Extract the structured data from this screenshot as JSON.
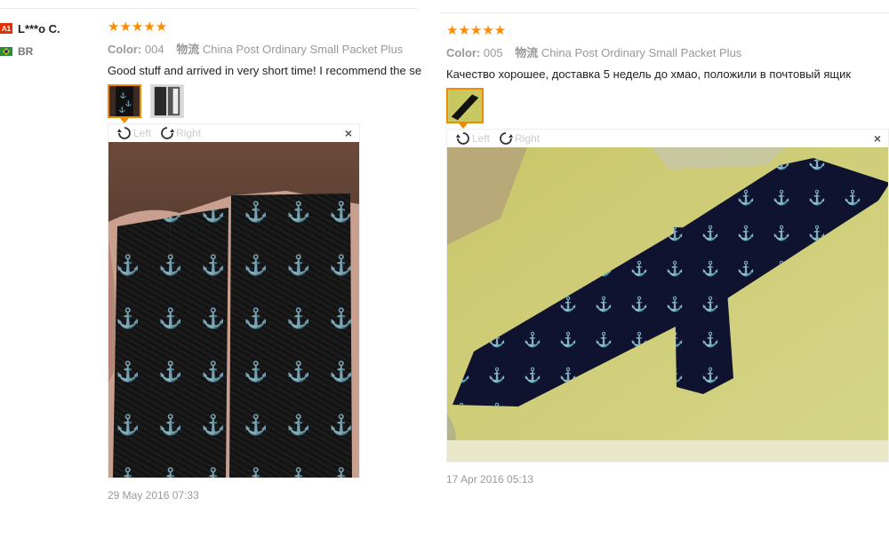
{
  "reviewer": {
    "badge": "A1",
    "name": "L***o C.",
    "country": "BR"
  },
  "reviews": [
    {
      "stars": "★★★★★",
      "color_label": "Color:",
      "color_value": "004",
      "shipping_label": "物流",
      "shipping_value": "China Post Ordinary Small Packet Plus",
      "text": "Good stuff and arrived in very short time! I recommend the se",
      "viewer": {
        "left_label": "Left",
        "right_label": "Right",
        "close": "×"
      },
      "date": "29 May 2016 07:33"
    },
    {
      "stars": "★★★★★",
      "color_label": "Color:",
      "color_value": "005",
      "shipping_label": "物流",
      "shipping_value": "China Post Ordinary Small Packet Plus",
      "text": "Качество хорошее, доставка 5 недель до хмао, положили в почтовый ящик",
      "viewer": {
        "left_label": "Left",
        "right_label": "Right",
        "close": "×"
      },
      "date": "17 Apr 2016 05:13"
    }
  ],
  "icons": {
    "rotate_left": "rotate-left-icon",
    "rotate_right": "rotate-right-icon",
    "close": "close-icon"
  },
  "colors": {
    "star": "#ff8a00",
    "badge": "#e62e04",
    "thumb_active": "#f08a00"
  }
}
